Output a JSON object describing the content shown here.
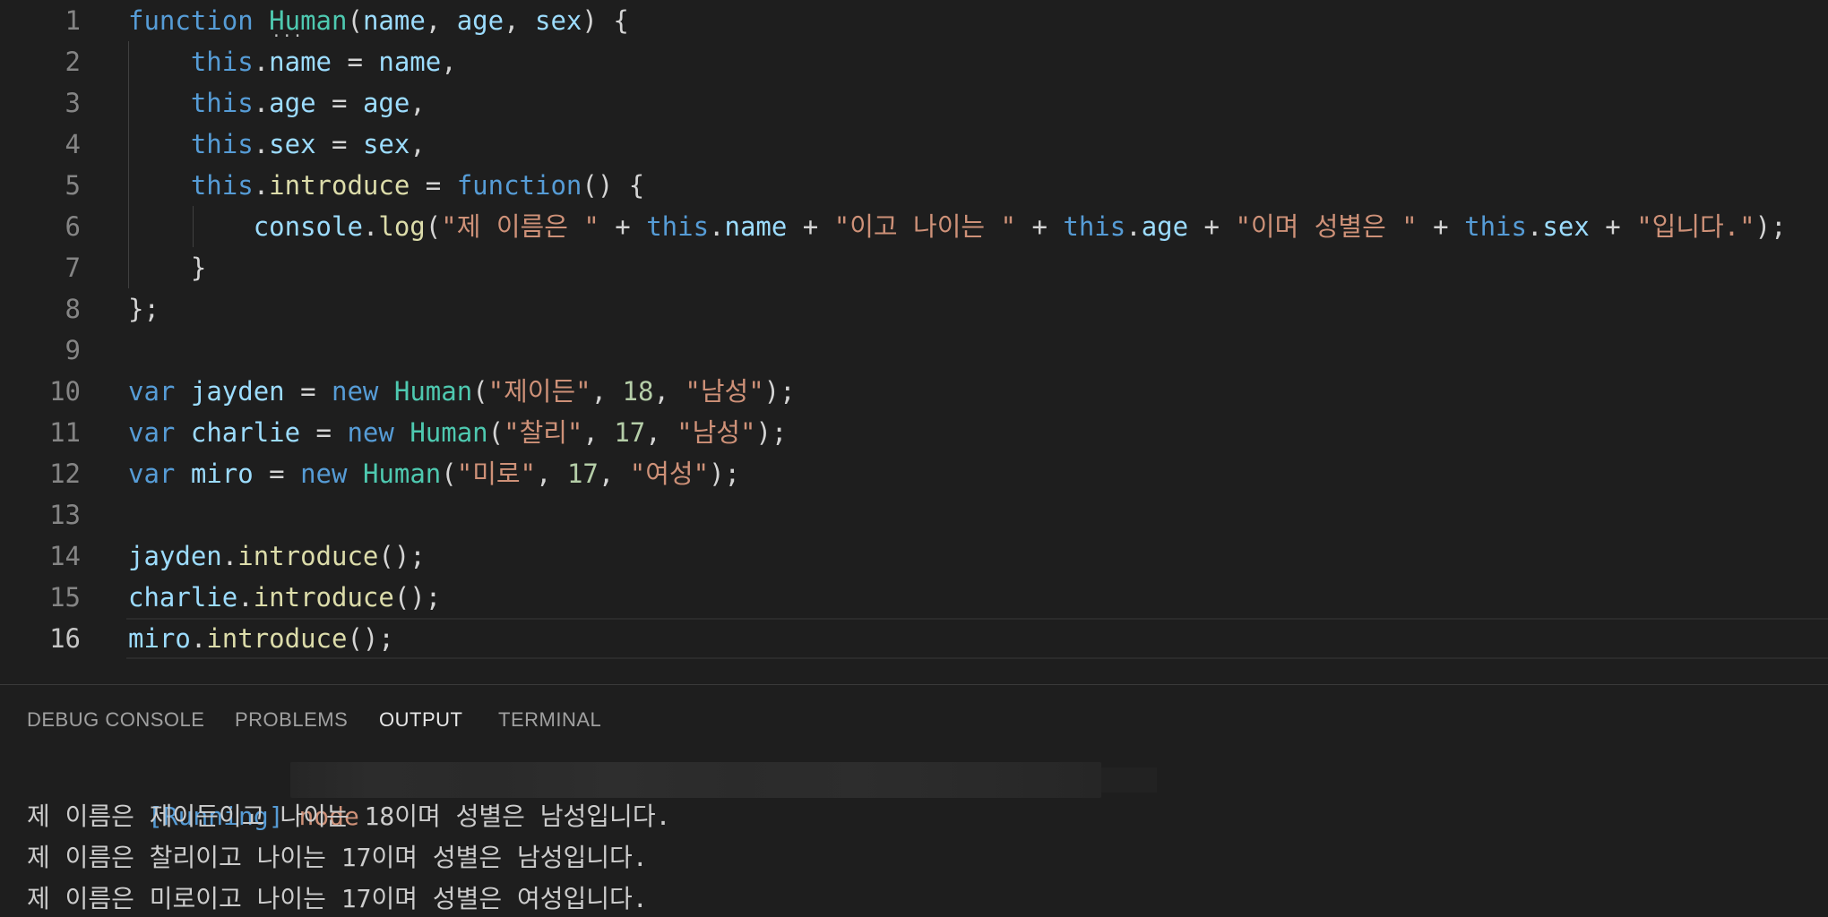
{
  "editor": {
    "lines": [
      {
        "n": "1",
        "tokens": [
          {
            "t": "function",
            "c": "kw"
          },
          {
            "t": " ",
            "c": "pun"
          },
          {
            "t": "Human",
            "c": "cls"
          },
          {
            "t": "(",
            "c": "pun"
          },
          {
            "t": "name",
            "c": "prm"
          },
          {
            "t": ", ",
            "c": "pun"
          },
          {
            "t": "age",
            "c": "prm"
          },
          {
            "t": ", ",
            "c": "pun"
          },
          {
            "t": "sex",
            "c": "prm"
          },
          {
            "t": ") {",
            "c": "pun"
          }
        ]
      },
      {
        "n": "2",
        "tokens": [
          {
            "t": "    ",
            "c": "pun"
          },
          {
            "t": "this",
            "c": "kw"
          },
          {
            "t": ".",
            "c": "pun"
          },
          {
            "t": "name",
            "c": "prm"
          },
          {
            "t": " = ",
            "c": "pun"
          },
          {
            "t": "name",
            "c": "prm"
          },
          {
            "t": ",",
            "c": "pun"
          }
        ]
      },
      {
        "n": "3",
        "tokens": [
          {
            "t": "    ",
            "c": "pun"
          },
          {
            "t": "this",
            "c": "kw"
          },
          {
            "t": ".",
            "c": "pun"
          },
          {
            "t": "age",
            "c": "prm"
          },
          {
            "t": " = ",
            "c": "pun"
          },
          {
            "t": "age",
            "c": "prm"
          },
          {
            "t": ",",
            "c": "pun"
          }
        ]
      },
      {
        "n": "4",
        "tokens": [
          {
            "t": "    ",
            "c": "pun"
          },
          {
            "t": "this",
            "c": "kw"
          },
          {
            "t": ".",
            "c": "pun"
          },
          {
            "t": "sex",
            "c": "prm"
          },
          {
            "t": " = ",
            "c": "pun"
          },
          {
            "t": "sex",
            "c": "prm"
          },
          {
            "t": ",",
            "c": "pun"
          }
        ]
      },
      {
        "n": "5",
        "tokens": [
          {
            "t": "    ",
            "c": "pun"
          },
          {
            "t": "this",
            "c": "kw"
          },
          {
            "t": ".",
            "c": "pun"
          },
          {
            "t": "introduce",
            "c": "fn"
          },
          {
            "t": " = ",
            "c": "pun"
          },
          {
            "t": "function",
            "c": "kw"
          },
          {
            "t": "() {",
            "c": "pun"
          }
        ]
      },
      {
        "n": "6",
        "tokens": [
          {
            "t": "        ",
            "c": "pun"
          },
          {
            "t": "console",
            "c": "prm"
          },
          {
            "t": ".",
            "c": "pun"
          },
          {
            "t": "log",
            "c": "fn"
          },
          {
            "t": "(",
            "c": "pun"
          },
          {
            "t": "\"제 이름은 \"",
            "c": "str"
          },
          {
            "t": " + ",
            "c": "pun"
          },
          {
            "t": "this",
            "c": "kw"
          },
          {
            "t": ".",
            "c": "pun"
          },
          {
            "t": "name",
            "c": "prm"
          },
          {
            "t": " + ",
            "c": "pun"
          },
          {
            "t": "\"이고 나이는 \"",
            "c": "str"
          },
          {
            "t": " + ",
            "c": "pun"
          },
          {
            "t": "this",
            "c": "kw"
          },
          {
            "t": ".",
            "c": "pun"
          },
          {
            "t": "age",
            "c": "prm"
          },
          {
            "t": " + ",
            "c": "pun"
          },
          {
            "t": "\"이며 성별은 \"",
            "c": "str"
          },
          {
            "t": " + ",
            "c": "pun"
          },
          {
            "t": "this",
            "c": "kw"
          },
          {
            "t": ".",
            "c": "pun"
          },
          {
            "t": "sex",
            "c": "prm"
          },
          {
            "t": " + ",
            "c": "pun"
          },
          {
            "t": "\"입니다.\"",
            "c": "str"
          },
          {
            "t": ");",
            "c": "pun"
          }
        ]
      },
      {
        "n": "7",
        "tokens": [
          {
            "t": "    }",
            "c": "pun"
          }
        ]
      },
      {
        "n": "8",
        "tokens": [
          {
            "t": "};",
            "c": "pun"
          }
        ]
      },
      {
        "n": "9",
        "tokens": []
      },
      {
        "n": "10",
        "tokens": [
          {
            "t": "var",
            "c": "kw"
          },
          {
            "t": " ",
            "c": "pun"
          },
          {
            "t": "jayden",
            "c": "prm"
          },
          {
            "t": " = ",
            "c": "pun"
          },
          {
            "t": "new",
            "c": "kw"
          },
          {
            "t": " ",
            "c": "pun"
          },
          {
            "t": "Human",
            "c": "cls"
          },
          {
            "t": "(",
            "c": "pun"
          },
          {
            "t": "\"제이든\"",
            "c": "str"
          },
          {
            "t": ", ",
            "c": "pun"
          },
          {
            "t": "18",
            "c": "num"
          },
          {
            "t": ", ",
            "c": "pun"
          },
          {
            "t": "\"남성\"",
            "c": "str"
          },
          {
            "t": ");",
            "c": "pun"
          }
        ]
      },
      {
        "n": "11",
        "tokens": [
          {
            "t": "var",
            "c": "kw"
          },
          {
            "t": " ",
            "c": "pun"
          },
          {
            "t": "charlie",
            "c": "prm"
          },
          {
            "t": " = ",
            "c": "pun"
          },
          {
            "t": "new",
            "c": "kw"
          },
          {
            "t": " ",
            "c": "pun"
          },
          {
            "t": "Human",
            "c": "cls"
          },
          {
            "t": "(",
            "c": "pun"
          },
          {
            "t": "\"찰리\"",
            "c": "str"
          },
          {
            "t": ", ",
            "c": "pun"
          },
          {
            "t": "17",
            "c": "num"
          },
          {
            "t": ", ",
            "c": "pun"
          },
          {
            "t": "\"남성\"",
            "c": "str"
          },
          {
            "t": ");",
            "c": "pun"
          }
        ]
      },
      {
        "n": "12",
        "tokens": [
          {
            "t": "var",
            "c": "kw"
          },
          {
            "t": " ",
            "c": "pun"
          },
          {
            "t": "miro",
            "c": "prm"
          },
          {
            "t": " = ",
            "c": "pun"
          },
          {
            "t": "new",
            "c": "kw"
          },
          {
            "t": " ",
            "c": "pun"
          },
          {
            "t": "Human",
            "c": "cls"
          },
          {
            "t": "(",
            "c": "pun"
          },
          {
            "t": "\"미로\"",
            "c": "str"
          },
          {
            "t": ", ",
            "c": "pun"
          },
          {
            "t": "17",
            "c": "num"
          },
          {
            "t": ", ",
            "c": "pun"
          },
          {
            "t": "\"여성\"",
            "c": "str"
          },
          {
            "t": ");",
            "c": "pun"
          }
        ]
      },
      {
        "n": "13",
        "tokens": []
      },
      {
        "n": "14",
        "tokens": [
          {
            "t": "jayden",
            "c": "prm"
          },
          {
            "t": ".",
            "c": "pun"
          },
          {
            "t": "introduce",
            "c": "fn"
          },
          {
            "t": "();",
            "c": "pun"
          }
        ]
      },
      {
        "n": "15",
        "tokens": [
          {
            "t": "charlie",
            "c": "prm"
          },
          {
            "t": ".",
            "c": "pun"
          },
          {
            "t": "introduce",
            "c": "fn"
          },
          {
            "t": "();",
            "c": "pun"
          }
        ]
      },
      {
        "n": "16",
        "tokens": [
          {
            "t": "miro",
            "c": "prm"
          },
          {
            "t": ".",
            "c": "pun"
          },
          {
            "t": "introduce",
            "c": "fn"
          },
          {
            "t": "();",
            "c": "pun"
          }
        ]
      }
    ],
    "active_line": "16",
    "hint_dots": "···"
  },
  "panel": {
    "tabs": [
      {
        "label": "DEBUG CONSOLE",
        "active": false
      },
      {
        "label": "PROBLEMS",
        "active": false
      },
      {
        "label": "OUTPUT",
        "active": true
      },
      {
        "label": "TERMINAL",
        "active": false
      }
    ],
    "output": {
      "running_tag": "[Running]",
      "running_cmd": "node",
      "lines": [
        "제 이름은 제이든이고 나이는 18이며 성별은 남성입니다.",
        "제 이름은 찰리이고 나이는 17이며 성별은 남성입니다.",
        "제 이름은 미로이고 나이는 17이며 성별은 여성입니다."
      ]
    }
  },
  "colors": {
    "background": "#1e1e1e",
    "keyword": "#569cd6",
    "class": "#4ec9b0",
    "variable": "#9cdcfe",
    "function": "#dcdcaa",
    "string": "#ce9178",
    "number": "#b5cea8"
  }
}
